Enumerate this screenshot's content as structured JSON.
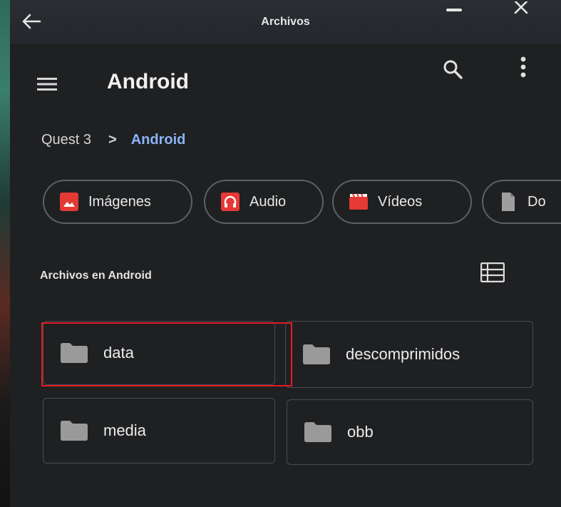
{
  "window": {
    "title": "Archivos"
  },
  "appbar": {
    "title": "Android"
  },
  "breadcrumb": {
    "root": "Quest 3",
    "separator": ">",
    "current": "Android"
  },
  "chips": [
    {
      "label": "Imágenes",
      "icon": "image-icon",
      "color": "#e53935"
    },
    {
      "label": "Audio",
      "icon": "headphones-icon",
      "color": "#e53935"
    },
    {
      "label": "Vídeos",
      "icon": "video-icon",
      "color": "#e53935"
    },
    {
      "label": "Do",
      "icon": "document-icon",
      "color": "#9e9e9e"
    }
  ],
  "section": {
    "label": "Archivos en Android"
  },
  "folders": [
    {
      "name": "data"
    },
    {
      "name": "descomprimidos"
    },
    {
      "name": "media"
    },
    {
      "name": "obb"
    }
  ],
  "colors": {
    "accent": "#8ab4f8",
    "highlight": "#e21b22",
    "folder": "#9a9a9a"
  }
}
